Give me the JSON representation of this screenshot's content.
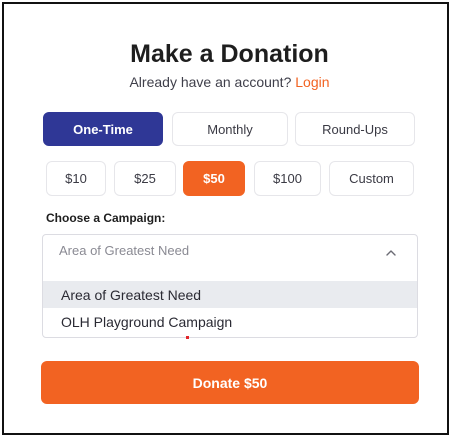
{
  "header": {
    "title": "Make a Donation",
    "subtitle_text": "Already have an account?",
    "login_link": "Login"
  },
  "frequency": {
    "options": [
      {
        "label": "One-Time",
        "selected": true
      },
      {
        "label": "Monthly",
        "selected": false
      },
      {
        "label": "Round-Ups",
        "selected": false
      }
    ]
  },
  "amounts": {
    "options": [
      {
        "label": "$10",
        "selected": false
      },
      {
        "label": "$25",
        "selected": false
      },
      {
        "label": "$50",
        "selected": true
      },
      {
        "label": "$100",
        "selected": false
      },
      {
        "label": "Custom",
        "selected": false
      }
    ]
  },
  "campaign": {
    "label": "Choose a Campaign:",
    "placeholder": "Area of Greatest Need",
    "expanded": true,
    "options": [
      {
        "label": "Area of Greatest Need",
        "highlighted": true
      },
      {
        "label": "OLH Playground Campaign",
        "highlighted": false
      }
    ]
  },
  "donate_button": {
    "label": "Donate $50"
  },
  "colors": {
    "accent_orange": "#f26322",
    "accent_blue": "#2f3796"
  }
}
